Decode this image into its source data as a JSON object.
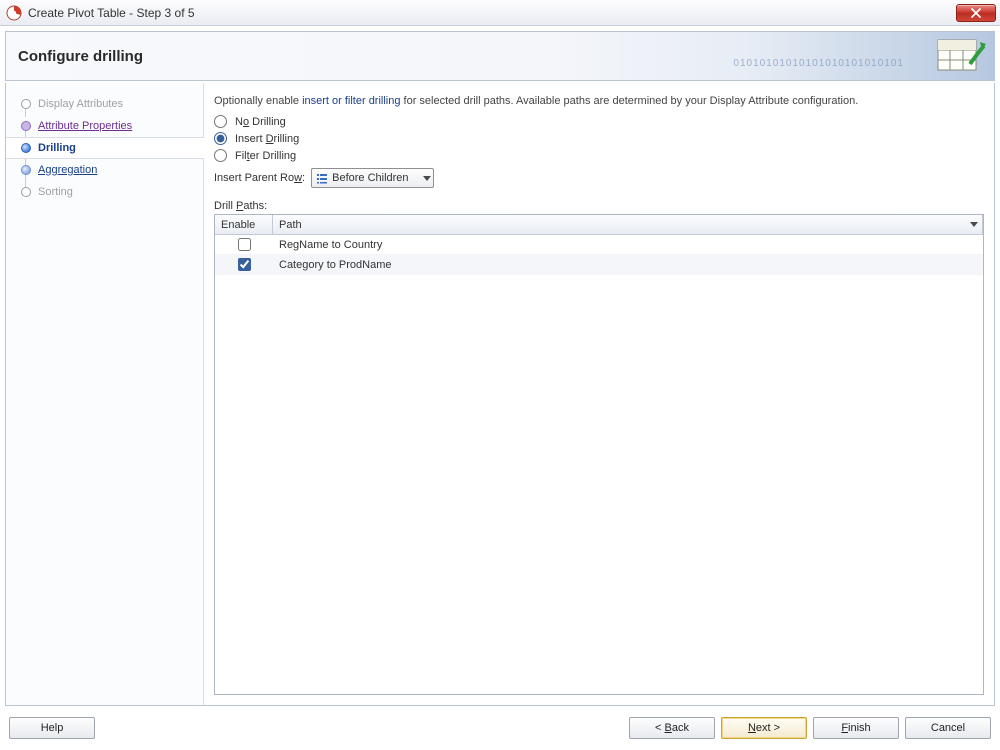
{
  "window": {
    "title": "Create Pivot Table - Step 3 of 5"
  },
  "header": {
    "title": "Configure drilling",
    "decor_digits": "01010101010101010101010101"
  },
  "nav": {
    "items": [
      {
        "label": "Display Attributes",
        "state": "completed"
      },
      {
        "label": "Attribute Properties",
        "state": "visited"
      },
      {
        "label": "Drilling",
        "state": "current"
      },
      {
        "label": "Aggregation",
        "state": "pending"
      },
      {
        "label": "Sorting",
        "state": "future"
      }
    ]
  },
  "intro": {
    "prefix": "Optionally enable ",
    "link": "insert or filter drilling",
    "suffix": " for selected drill paths. Available paths are determined by your Display Attribute configuration."
  },
  "radios": {
    "none": {
      "pre": "N",
      "mn": "o",
      "post": " Drilling",
      "checked": false
    },
    "insert": {
      "pre": "Insert ",
      "mn": "D",
      "post": "rilling",
      "checked": true
    },
    "filter": {
      "pre": "Fil",
      "mn": "t",
      "post": "er Drilling",
      "checked": false
    }
  },
  "insert_parent": {
    "label_pre": "Insert Parent Ro",
    "label_mn": "w",
    "label_post": ":",
    "value": "Before Children"
  },
  "table": {
    "caption_pre": "Drill ",
    "caption_mn": "P",
    "caption_post": "aths:",
    "cols": {
      "enable": "Enable",
      "path": "Path"
    },
    "rows": [
      {
        "enabled": false,
        "path": "RegName to Country"
      },
      {
        "enabled": true,
        "path": "Category to ProdName"
      }
    ]
  },
  "footer": {
    "help": "Help",
    "back_pre": "< ",
    "back_mn": "B",
    "back_post": "ack",
    "next_pre": "",
    "next_mn": "N",
    "next_post": "ext >",
    "finish_pre": "",
    "finish_mn": "F",
    "finish_post": "inish",
    "cancel": "Cancel"
  }
}
